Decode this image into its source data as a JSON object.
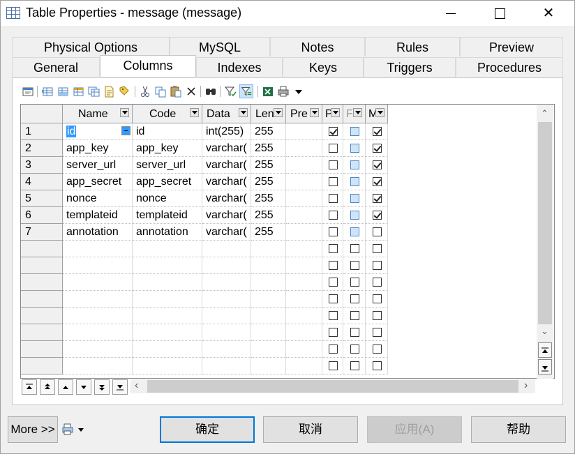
{
  "window": {
    "title": "Table Properties - message (message)"
  },
  "tabs_row1": [
    "Physical Options",
    "MySQL",
    "Notes",
    "Rules",
    "Preview"
  ],
  "tabs_row2": [
    "General",
    "Columns",
    "Indexes",
    "Keys",
    "Triggers",
    "Procedures"
  ],
  "active_tab": "Columns",
  "toolbar_icons": [
    "properties-icon",
    "insert-row-icon",
    "add-row-icon",
    "add-columns-icon",
    "reuse-columns-icon",
    "new-icon",
    "label-icon",
    "cut-icon",
    "copy-icon",
    "paste-icon",
    "delete-icon",
    "find-icon",
    "filter-icon",
    "customize-columns-icon",
    "excel-export-icon",
    "print-icon",
    "dropdown-arrow-icon"
  ],
  "grid": {
    "headers": [
      "Name",
      "Code",
      "Data",
      "Len",
      "Pre",
      "P",
      "F",
      "M"
    ],
    "rows": [
      {
        "num": "1",
        "name": "id",
        "code": "id",
        "data": "int(255)",
        "len": "255",
        "pre": "",
        "p": true,
        "f": false,
        "m": true
      },
      {
        "num": "2",
        "name": "app_key",
        "code": "app_key",
        "data": "varchar(",
        "len": "255",
        "pre": "",
        "p": false,
        "f": false,
        "m": true
      },
      {
        "num": "3",
        "name": "server_url",
        "code": "server_url",
        "data": "varchar(",
        "len": "255",
        "pre": "",
        "p": false,
        "f": false,
        "m": true
      },
      {
        "num": "4",
        "name": "app_secret",
        "code": "app_secret",
        "data": "varchar(",
        "len": "255",
        "pre": "",
        "p": false,
        "f": false,
        "m": true
      },
      {
        "num": "5",
        "name": "nonce",
        "code": "nonce",
        "data": "varchar(",
        "len": "255",
        "pre": "",
        "p": false,
        "f": false,
        "m": true
      },
      {
        "num": "6",
        "name": "templateid",
        "code": "templateid",
        "data": "varchar(",
        "len": "255",
        "pre": "",
        "p": false,
        "f": false,
        "m": true
      },
      {
        "num": "7",
        "name": "annotation",
        "code": "annotation",
        "data": "varchar(",
        "len": "255",
        "pre": "",
        "p": false,
        "f": false,
        "m": false
      }
    ],
    "empty_rows": 8,
    "selected_cell": "rows.0.name"
  },
  "nav_buttons": [
    "move-top-icon",
    "move-page-up-icon",
    "move-up-icon",
    "move-down-icon",
    "move-page-down-icon",
    "move-bottom-icon"
  ],
  "footer": {
    "more_label": "More >>",
    "print_icon": "print-icon",
    "ok_label": "确定",
    "cancel_label": "取消",
    "apply_label": "应用(A)",
    "help_label": "帮助"
  }
}
